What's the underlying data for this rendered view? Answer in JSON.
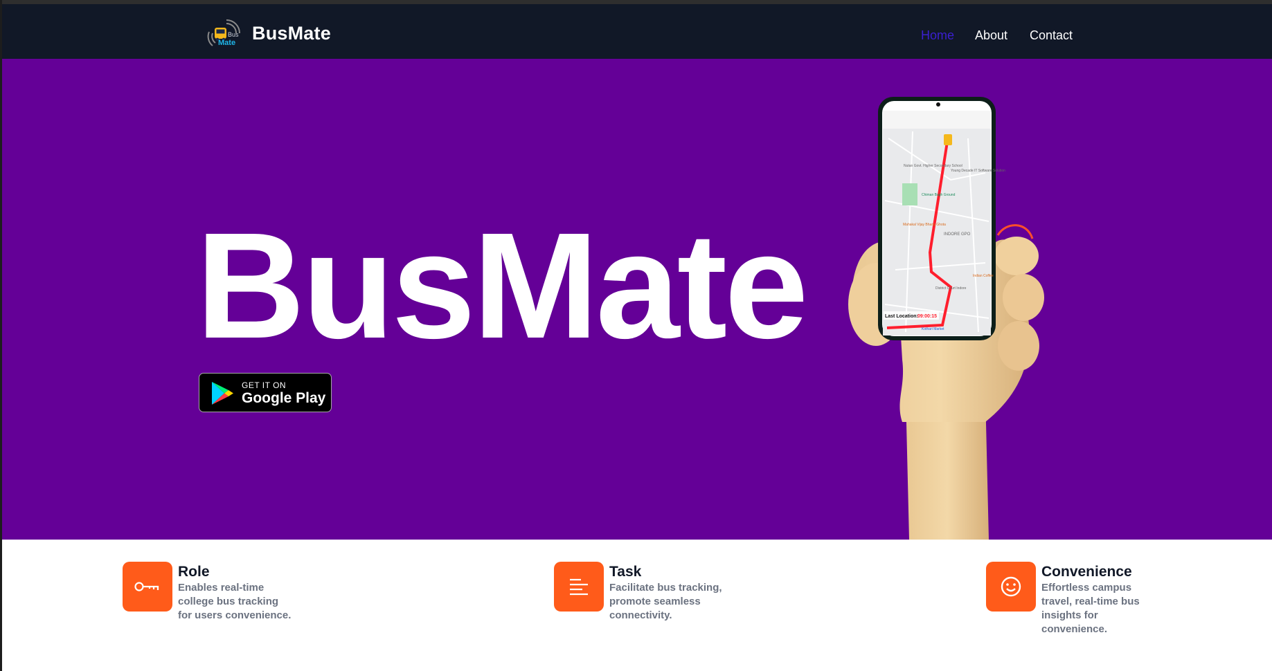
{
  "navbar": {
    "logo_text_top": "Bus",
    "logo_text_bottom": "Mate",
    "brand": "BusMate",
    "links": [
      {
        "label": "Home",
        "active": true
      },
      {
        "label": "About",
        "active": false
      },
      {
        "label": "Contact",
        "active": false
      }
    ]
  },
  "hero": {
    "title": "BusMate",
    "background": "#640097",
    "store_badge": {
      "small": "GET IT ON",
      "big": "Google Play"
    },
    "phone_screen": {
      "last_location_label": "Last Location:",
      "last_location_time": "09:00:15",
      "map_labels": [
        "INDORE GPO",
        "Chiman Bagh Ground",
        "Mahakal Vijay Bhang Ghota",
        "Young Decade IT Software Solution",
        "Nutan Govt. Higher Secondary School",
        "District Court Indore",
        "Indian Coffee",
        "Kothari Market"
      ]
    }
  },
  "features": [
    {
      "icon": "key-icon",
      "title": "Role",
      "desc": [
        "Enables real-time",
        "college bus tracking",
        "for users convenience."
      ]
    },
    {
      "icon": "text-lines-icon",
      "title": "Task",
      "desc": [
        "Facilitate bus tracking,",
        "promote seamless",
        "connectivity."
      ]
    },
    {
      "icon": "smiley-icon",
      "title": "Convenience",
      "desc": [
        "Effortless campus",
        "travel, real-time bus",
        "insights for",
        "convenience."
      ]
    }
  ],
  "colors": {
    "navbar": "#111827",
    "accent": "#ff5b1a",
    "active_link": "#3b1fd1",
    "route": "#ff1e2d"
  }
}
